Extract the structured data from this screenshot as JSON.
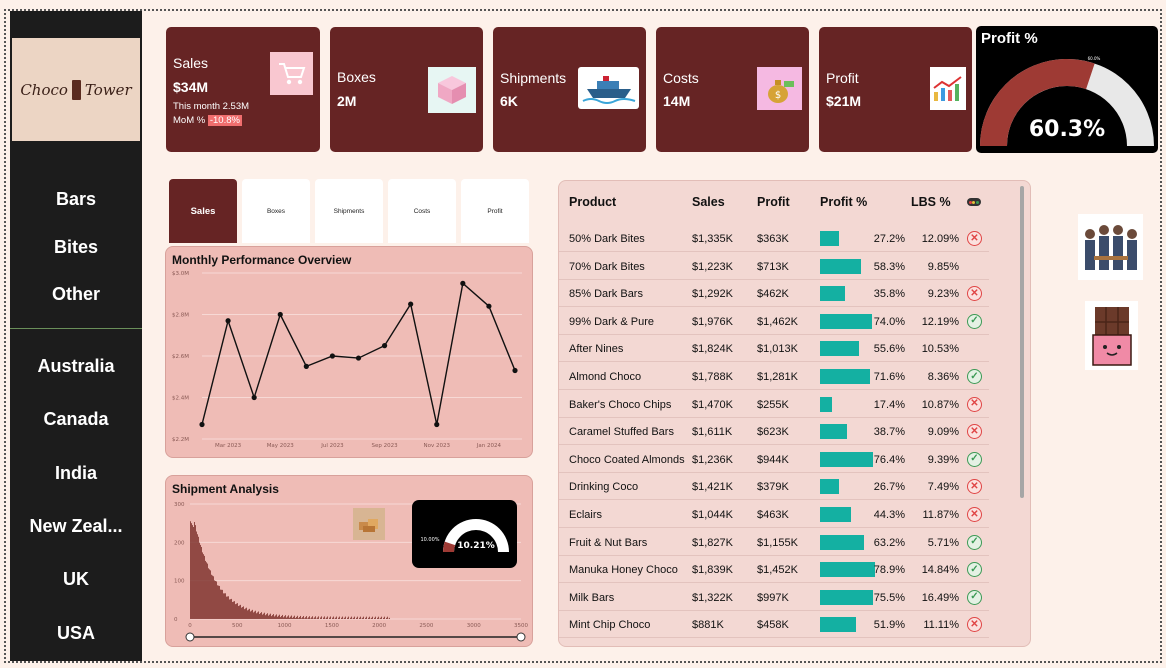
{
  "logo": {
    "text_left": "Choco",
    "text_right": "Tower"
  },
  "nav": {
    "categories": [
      "Bars",
      "Bites",
      "Other"
    ],
    "countries": [
      "Australia",
      "Canada",
      "India",
      "New Zeal...",
      "UK",
      "USA"
    ]
  },
  "kpis": {
    "sales": {
      "label": "Sales",
      "value": "$34M",
      "this_month": "This month 2.53M",
      "mom_label": "MoM %",
      "mom_value": "-10.8%",
      "icon": "shopping-cart-icon"
    },
    "boxes": {
      "label": "Boxes",
      "value": "2M",
      "icon": "box-icon"
    },
    "shipments": {
      "label": "Shipments",
      "value": "6K",
      "icon": "ship-icon"
    },
    "costs": {
      "label": "Costs",
      "value": "14M",
      "icon": "money-bag-icon"
    },
    "profit": {
      "label": "Profit",
      "value": "$21M",
      "icon": "growth-chart-icon"
    }
  },
  "profit_gauge": {
    "title": "Profit %",
    "value": "60.3%",
    "target_label": "60.0%",
    "fraction": 0.603
  },
  "tabs": [
    "Sales",
    "Boxes",
    "Shipments",
    "Costs",
    "Profit"
  ],
  "monthly": {
    "title": "Monthly Performance Overview",
    "y_ticks": [
      "$3.0M",
      "$2.8M",
      "$2.6M",
      "$2.4M",
      "$2.2M"
    ],
    "x_ticks": [
      "Mar 2023",
      "May 2023",
      "Jul 2023",
      "Sep 2023",
      "Nov 2023",
      "Jan 2024"
    ],
    "values": [
      2.27,
      2.77,
      2.4,
      2.8,
      2.55,
      2.6,
      2.59,
      2.65,
      2.85,
      2.27,
      2.95,
      2.84,
      2.53
    ]
  },
  "shipment": {
    "title": "Shipment Analysis",
    "y_ticks": [
      "300",
      "200",
      "100",
      "0"
    ],
    "x_ticks": [
      "0",
      "500",
      "1000",
      "1500",
      "2000",
      "2500",
      "3000",
      "3500"
    ],
    "gauge_value": "10.21%",
    "gauge_target": "10.00%",
    "gauge_fraction": 0.1021,
    "icon": "boxes-icon"
  },
  "table": {
    "headers": [
      "Product",
      "Sales",
      "Profit",
      "Profit %",
      "LBS %"
    ],
    "rows": [
      {
        "product": "50% Dark Bites",
        "sales": "$1,335K",
        "profit": "$363K",
        "pct": 27.2,
        "pct_label": "27.2%",
        "lbs": "12.09%",
        "status": "cross"
      },
      {
        "product": "70% Dark Bites",
        "sales": "$1,223K",
        "profit": "$713K",
        "pct": 58.3,
        "pct_label": "58.3%",
        "lbs": "9.85%",
        "status": "none"
      },
      {
        "product": "85% Dark Bars",
        "sales": "$1,292K",
        "profit": "$462K",
        "pct": 35.8,
        "pct_label": "35.8%",
        "lbs": "9.23%",
        "status": "cross"
      },
      {
        "product": "99% Dark & Pure",
        "sales": "$1,976K",
        "profit": "$1,462K",
        "pct": 74.0,
        "pct_label": "74.0%",
        "lbs": "12.19%",
        "status": "check"
      },
      {
        "product": "After Nines",
        "sales": "$1,824K",
        "profit": "$1,013K",
        "pct": 55.6,
        "pct_label": "55.6%",
        "lbs": "10.53%",
        "status": "none"
      },
      {
        "product": "Almond Choco",
        "sales": "$1,788K",
        "profit": "$1,281K",
        "pct": 71.6,
        "pct_label": "71.6%",
        "lbs": "8.36%",
        "status": "check"
      },
      {
        "product": "Baker's Choco Chips",
        "sales": "$1,470K",
        "profit": "$255K",
        "pct": 17.4,
        "pct_label": "17.4%",
        "lbs": "10.87%",
        "status": "cross"
      },
      {
        "product": "Caramel Stuffed Bars",
        "sales": "$1,611K",
        "profit": "$623K",
        "pct": 38.7,
        "pct_label": "38.7%",
        "lbs": "9.09%",
        "status": "cross"
      },
      {
        "product": "Choco Coated Almonds",
        "sales": "$1,236K",
        "profit": "$944K",
        "pct": 76.4,
        "pct_label": "76.4%",
        "lbs": "9.39%",
        "status": "check"
      },
      {
        "product": "Drinking Coco",
        "sales": "$1,421K",
        "profit": "$379K",
        "pct": 26.7,
        "pct_label": "26.7%",
        "lbs": "7.49%",
        "status": "cross"
      },
      {
        "product": "Eclairs",
        "sales": "$1,044K",
        "profit": "$463K",
        "pct": 44.3,
        "pct_label": "44.3%",
        "lbs": "11.87%",
        "status": "cross"
      },
      {
        "product": "Fruit & Nut Bars",
        "sales": "$1,827K",
        "profit": "$1,155K",
        "pct": 63.2,
        "pct_label": "63.2%",
        "lbs": "5.71%",
        "status": "check"
      },
      {
        "product": "Manuka Honey Choco",
        "sales": "$1,839K",
        "profit": "$1,452K",
        "pct": 78.9,
        "pct_label": "78.9%",
        "lbs": "14.84%",
        "status": "check"
      },
      {
        "product": "Milk Bars",
        "sales": "$1,322K",
        "profit": "$997K",
        "pct": 75.5,
        "pct_label": "75.5%",
        "lbs": "16.49%",
        "status": "check"
      },
      {
        "product": "Mint Chip Choco",
        "sales": "$881K",
        "profit": "$458K",
        "pct": 51.9,
        "pct_label": "51.9%",
        "lbs": "11.11%",
        "status": "cross"
      }
    ]
  },
  "side_images": [
    "team-illustration-icon",
    "chocolate-bar-character-icon"
  ],
  "colors": {
    "maroon": "#662424",
    "teal": "#14b0a2",
    "gauge_fill": "#9e3a34",
    "gauge_track": "#e8e8e8",
    "sidebar": "#1c1c1c"
  }
}
